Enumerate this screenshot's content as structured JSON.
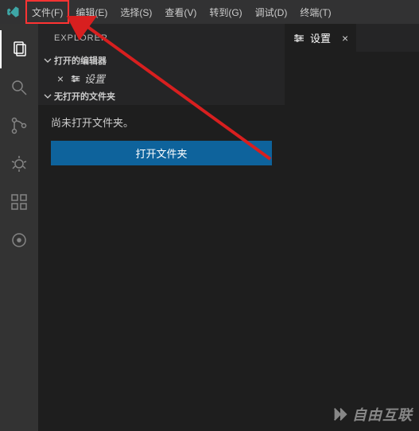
{
  "menubar": {
    "items": [
      "文件(F)",
      "编辑(E)",
      "选择(S)",
      "查看(V)",
      "转到(G)",
      "调试(D)",
      "终端(T)"
    ]
  },
  "sidebar": {
    "title": "EXPLORER",
    "openEditors": {
      "label": "打开的编辑器",
      "items": [
        {
          "label": "设置"
        }
      ]
    },
    "noFolder": {
      "label": "无打开的文件夹",
      "message": "尚未打开文件夹。",
      "button": "打开文件夹"
    }
  },
  "tabs": {
    "items": [
      {
        "label": "设置"
      }
    ]
  },
  "watermark": "自由互联"
}
